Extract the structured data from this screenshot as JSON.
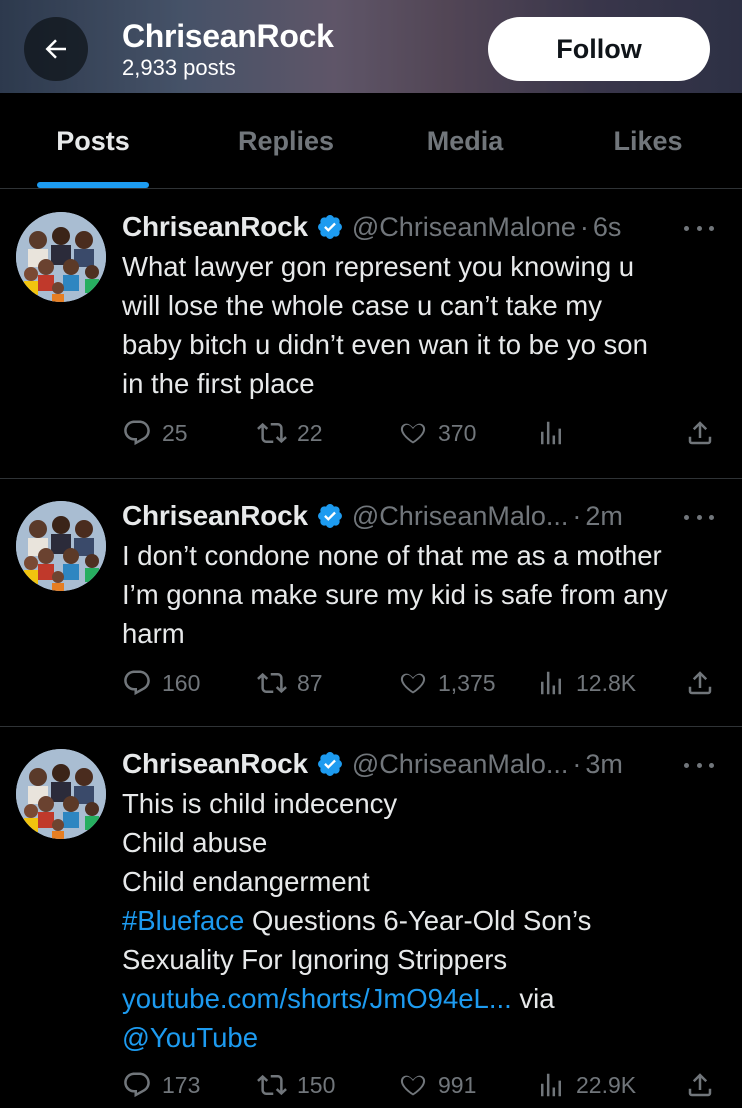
{
  "header": {
    "profile_name": "ChriseanRock",
    "post_count": "2,933 posts",
    "follow_label": "Follow",
    "background": "#4c5670"
  },
  "tabs": [
    {
      "label": "Posts",
      "active": true
    },
    {
      "label": "Replies",
      "active": false
    },
    {
      "label": "Media",
      "active": false
    },
    {
      "label": "Likes",
      "active": false
    }
  ],
  "colors": {
    "accent": "#1d9bf0",
    "muted": "#71767b",
    "text": "#e7e9ea",
    "background": "#000000",
    "divider": "#2f3336"
  },
  "tweets": [
    {
      "name": "ChriseanRock",
      "handle": "@ChriseanMalone",
      "sep": "·",
      "time": "6s",
      "lines": [
        "What lawyer gon represent you knowing u",
        "will lose the whole case u can’t take my",
        "baby bitch u didn’t even wan it to be yo son",
        "in the first place"
      ],
      "replies": "25",
      "reposts": "22",
      "likes": "370",
      "views": ""
    },
    {
      "name": "ChriseanRock",
      "handle": "@ChriseanMalo...",
      "sep": "·",
      "time": "2m",
      "lines": [
        "I don’t condone none of that me as a mother",
        "I’m gonna make sure my kid is safe from any",
        "harm"
      ],
      "replies": "160",
      "reposts": "87",
      "likes": "1,375",
      "views": "12.8K"
    },
    {
      "name": "ChriseanRock",
      "handle": "@ChriseanMalo...",
      "sep": "·",
      "time": "3m",
      "lines": [
        "This is child indecency",
        "Child abuse",
        "Child endangerment"
      ],
      "hashtag": "#Blueface",
      "hashtag_rest": " Questions 6-Year-Old Son’s",
      "line5": "Sexuality For Ignoring Strippers",
      "url": "youtube.com/shorts/JmO94eL...",
      "via": " via",
      "mention": "@YouTube",
      "replies": "173",
      "reposts": "150",
      "likes": "991",
      "views": "22.9K"
    }
  ]
}
